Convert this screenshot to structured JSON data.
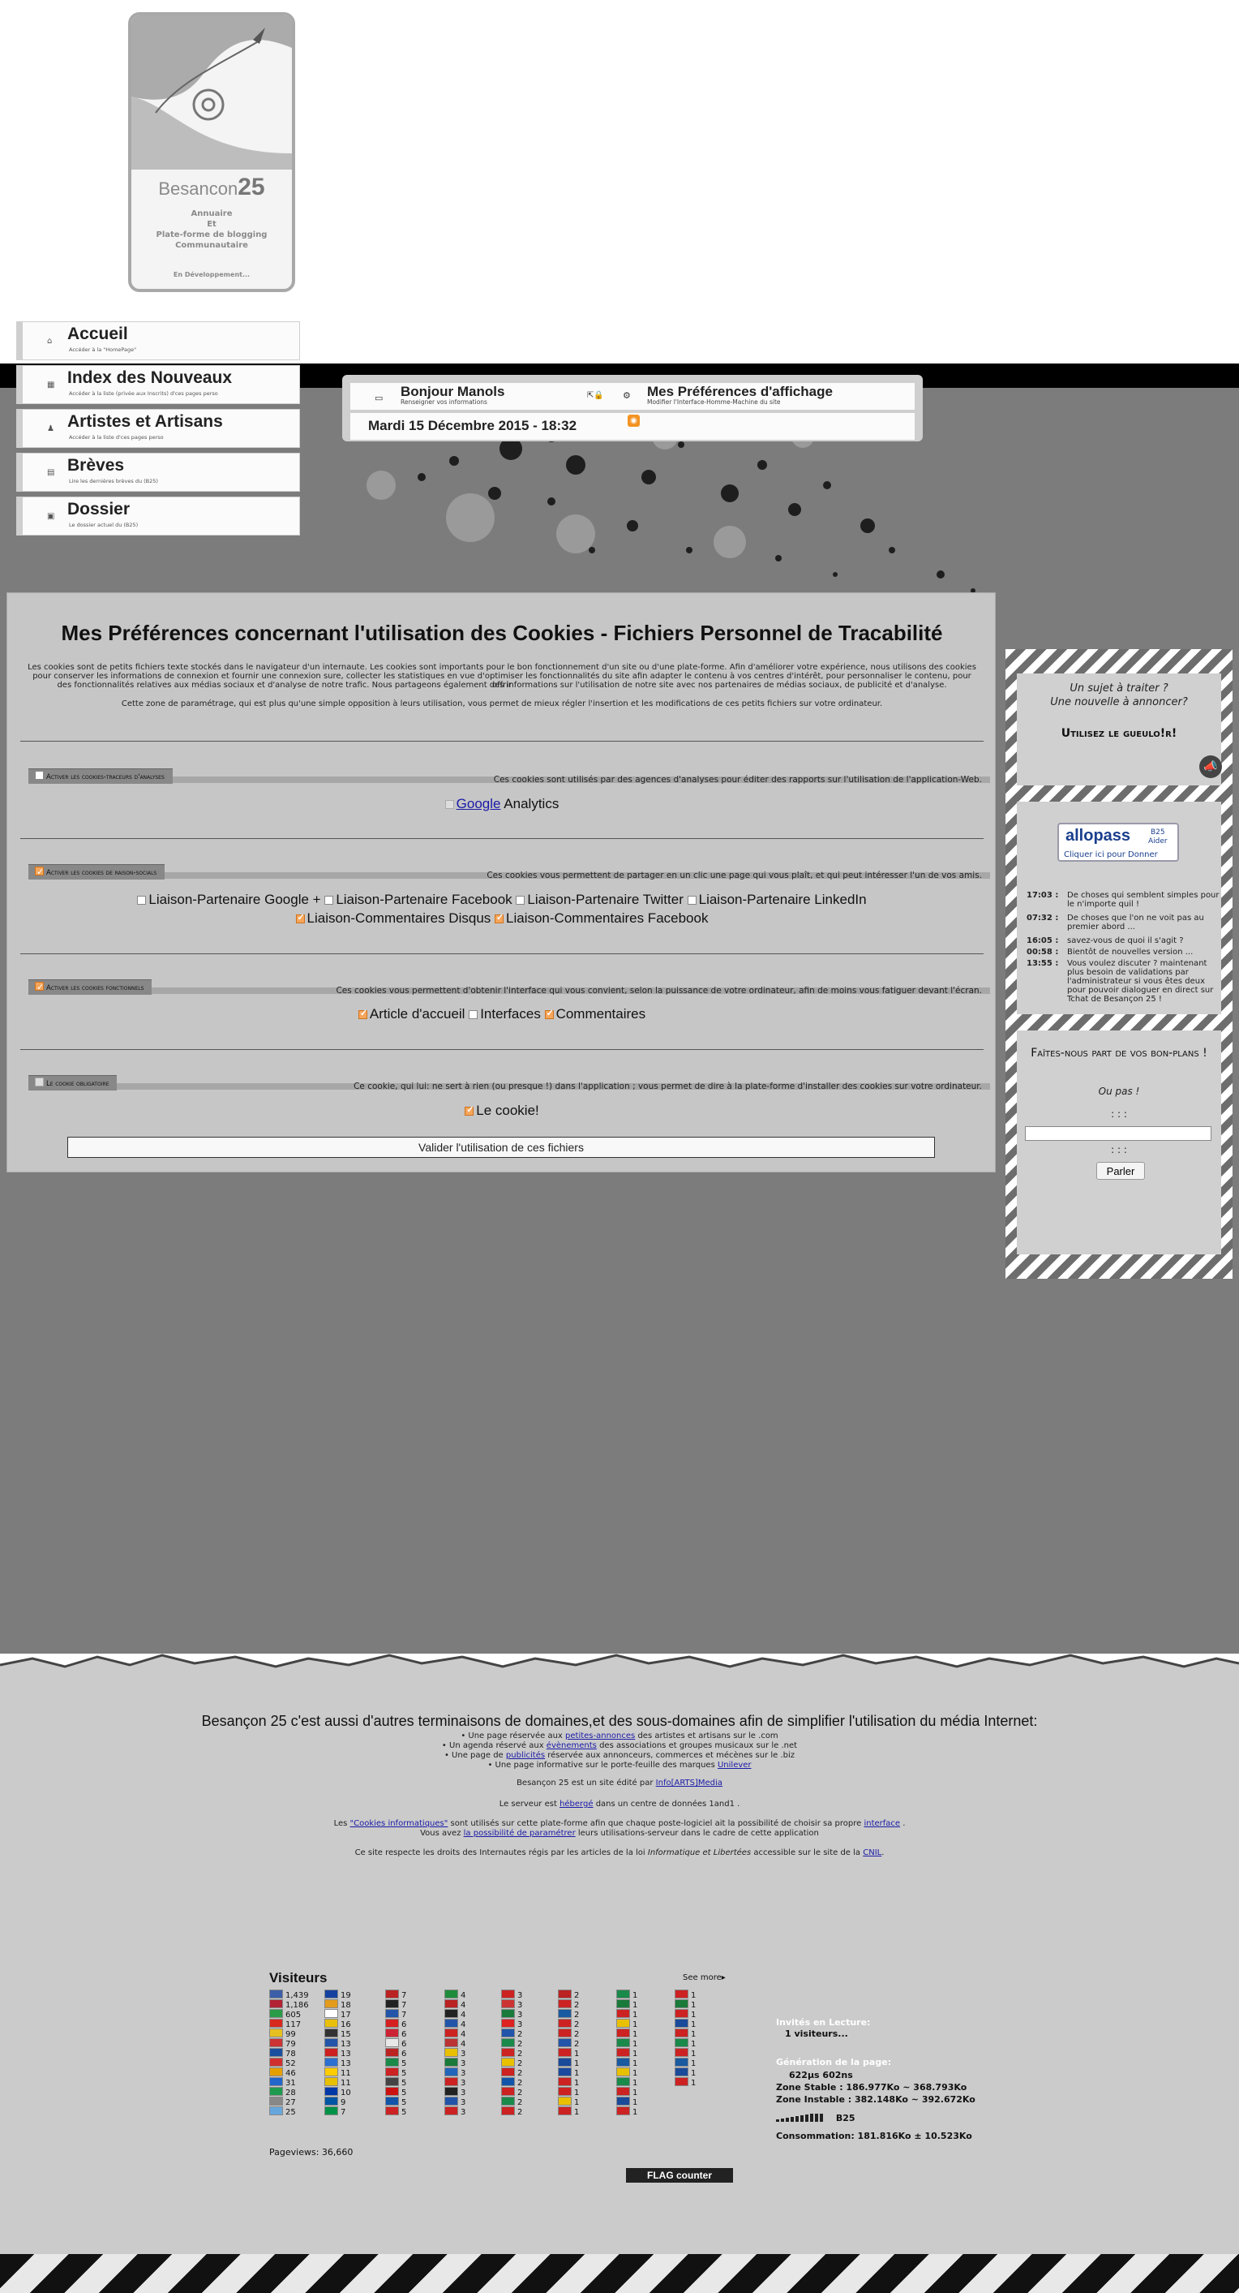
{
  "logo": {
    "name": "Besancon",
    "number": "25",
    "line1": "Annuaire",
    "line2": "Et",
    "line3": "Plate-forme de blogging",
    "line4": "Communautaire",
    "dev": "En Développement..."
  },
  "nav": [
    {
      "title": "Accueil",
      "sub": "Accéder à la \"HomePage\"",
      "icon": "home-icon"
    },
    {
      "title": "Index des Nouveaux",
      "sub": "Accéder à la liste (privée aux Inscrits) d'ces pages perso",
      "icon": "index-icon"
    },
    {
      "title": "Artistes et Artisans",
      "sub": "Accéder à la liste d'ces pages perso",
      "icon": "user-icon"
    },
    {
      "title": "Brèves",
      "sub": "Lire les dernières brèves du (B25)",
      "icon": "news-icon"
    },
    {
      "title": "Dossier",
      "sub": "Le dossier actuel du (B25)",
      "icon": "folder-icon"
    }
  ],
  "info_bar": {
    "user_title": "Bonjour Manols",
    "user_sub": "Renseigner vos informations",
    "prefs_title": "Mes Préférences d'affichage",
    "prefs_sub": "Modifier l'Interface-Homme-Machine du site",
    "date": "Mardi 15 Décembre 2015 - 18:32"
  },
  "cookies": {
    "title": "Mes Préférences concernant l'utilisation des Cookies - Fichiers Personnel de Tracabilité",
    "para1_l1": "Les cookies sont de petits fichiers texte stockés dans le navigateur d'un internaute. Les cookies sont importants pour le bon fonctionnement d'un site ou d'une plate-forme. Afin d'améliorer votre expérience, nous utilisons des cookies",
    "para1_l2": "pour conserver les informations de connexion et fournir une connexion sure, collecter les statistiques en vue d'optimiser les fonctionnalités du site afin adapter le contenu à vos centres d'intérêt, pour personnaliser le contenu, pour offrir",
    "para1_l3": "des fonctionnalités relatives aux médias sociaux et d'analyse de notre trafic. Nous partageons également des informations sur l'utilisation de notre site avec nos partenaires de médias sociaux, de publicité et d'analyse.",
    "para2": "Cette zone de paramétrage, qui est plus qu'une simple opposition à leurs utilisation, vous permet de mieux régler l'insertion et les modifications de ces petits fichiers sur votre ordinateur.",
    "sections": [
      {
        "tab": "Activer les cookies-traceurs d'analyses",
        "desc": "Ces cookies sont utilisés par des agences d'analyses pour éditer des rapports sur l'utilisation de l'application-Web.",
        "options": [
          "Google Analytics"
        ]
      },
      {
        "tab": "Activer les cookies de raison-socials",
        "desc": "Ces cookies vous permettent de partager en un clic une page qui vous plaît, et qui peut intéresser l'un de vos amis.",
        "options": [
          "Liaison-Partenaire Google +",
          "Liaison-Partenaire Facebook",
          "Liaison-Partenaire Twitter",
          "Liaison-Partenaire LinkedIn",
          "Liaison-Commentaires Disqus",
          "Liaison-Commentaires Facebook"
        ]
      },
      {
        "tab": "Activer les cookies fonctionnels",
        "desc": "Ces cookies vous permettent d'obtenir l'interface qui vous convient, selon la puissance de votre ordinateur, afin de moins vous fatiguer devant l'écran.",
        "options": [
          "Article d'accueil",
          "Interfaces",
          "Commentaires"
        ]
      },
      {
        "tab": "Le cookie obligatoire",
        "desc": "Ce cookie, qui lui: ne sert à rien (ou presque !) dans l'application ; vous permet de dire à la plate-forme d'installer des cookies sur votre ordinateur.",
        "options": [
          "Le cookie!"
        ]
      }
    ],
    "google_link": "Google",
    "analytics_text": "Analytics",
    "validate": "Valider l'utilisation de ces fichiers"
  },
  "sidebar": {
    "q1": "Un sujet à traiter ?",
    "q2": "Une nouvelle à annoncer?",
    "cta": "Utilisez le gueulo!r!",
    "allopass_brand": "allopass",
    "allopass_tag1": "B25",
    "allopass_tag2": "Aider",
    "allopass_cta": "Cliquer ici pour Donner",
    "chat": [
      {
        "time": "17:03 :",
        "msg": "De choses qui semblent simples pour le n'importe quil !"
      },
      {
        "time": "07:32 :",
        "msg": "De choses que l'on ne voit pas au premier abord ..."
      },
      {
        "time": "16:05 :",
        "msg": "savez-vous de quoi il s'agit ?"
      },
      {
        "time": "00:58 :",
        "msg": "Bientôt de nouvelles version ..."
      },
      {
        "time": "13:55 :",
        "msg": "Vous voulez discuter ? maintenant plus besoin de validations par l'administrateur si vous êtes deux pour pouvoir dialoguer en direct sur Tchat de Besançon 25 !"
      }
    ],
    "bon_plans": "Faîtes-nous part de vos bon-plans !",
    "ou_pas": "Ou pas !",
    "dots": ": : :",
    "dots2": ": : :",
    "speak": "Parler"
  },
  "footer": {
    "head": "Besançon 25 c'est aussi d'autres terminaisons de domaines,et des sous-domaines afin de simplifier l'utilisation du média Internet:",
    "l1_pre": "• Une page réservée aux",
    "l1_link": "petites-annonces",
    "l1_post": "des artistes et artisans sur le .com",
    "l2_pre": "• Un agenda réservé aux",
    "l2_link": "évènements",
    "l2_post": "des associations et groupes musicaux sur le .net",
    "l3_pre": "• Une page de",
    "l3_link": "publicités",
    "l3_post": "réservée aux annonceurs, commerces et mécènes sur le .biz",
    "l4_pre": "• Une page informative sur le porte-feuille des marques",
    "l4_link": "Unilever",
    "l5_pre": "Besançon 25 est un site édité par",
    "l5_link": "Info[ARTS]Media",
    "l6_pre": "Le serveur est",
    "l6_link": "hébergé",
    "l6_post": "dans un centre de données 1and1 .",
    "l7_pre": "Les",
    "l7_link": "\"Cookies informatiques\"",
    "l7_post": "sont utilisés sur cette plate-forme afin que chaque poste-logiciel ait la possibilité de choisir sa propre",
    "l7_link2": "interface",
    "l7_end": ".",
    "l8_pre": "Vous avez",
    "l8_link": "la possibilité de paramétrer",
    "l8_post": "leurs utilisations-serveur dans le cadre de cette application",
    "l9_pre": "Ce site respecte les droits des Internautes régis par les articles de la loi",
    "l9_em": "Informatique et Libertées",
    "l9_post": "accessible sur le site de la",
    "l9_link": "CNIL"
  },
  "visitors": {
    "title": "Visiteurs",
    "see_more": "See more▸",
    "pageviews": "Pageviews: 36,660",
    "columns": [
      [
        [
          "#3c5fa8",
          "1,439"
        ],
        [
          "#b22234",
          "1,186"
        ],
        [
          "#2a9c48",
          "605"
        ],
        [
          "#d7291e",
          "117"
        ],
        [
          "#e6c020",
          "99"
        ],
        [
          "#cc3333",
          "79"
        ],
        [
          "#1a4fa0",
          "78"
        ],
        [
          "#d12f2f",
          "52"
        ],
        [
          "#e5a000",
          "46"
        ],
        [
          "#2266cc",
          "31"
        ],
        [
          "#1e9a4e",
          "28"
        ],
        [
          "#888888",
          "27"
        ],
        [
          "#67a6dd",
          "25"
        ]
      ],
      [
        [
          "#1540a0",
          "19"
        ],
        [
          "#e39b1b",
          "18"
        ],
        [
          "#ffffff",
          "17"
        ],
        [
          "#e8c00a",
          "16"
        ],
        [
          "#333333",
          "15"
        ],
        [
          "#2255aa",
          "13"
        ],
        [
          "#cf2020",
          "13"
        ],
        [
          "#2b6fd0",
          "13"
        ],
        [
          "#ffcc00",
          "11"
        ],
        [
          "#e8c000",
          "11"
        ],
        [
          "#0038a8",
          "10"
        ],
        [
          "#0055a4",
          "9"
        ],
        [
          "#009246",
          "7"
        ]
      ],
      [
        [
          "#bb2222",
          "7"
        ],
        [
          "#222222",
          "7"
        ],
        [
          "#2255aa",
          "7"
        ],
        [
          "#d42020",
          "6"
        ],
        [
          "#cc2233",
          "6"
        ],
        [
          "#e8e8e8",
          "6"
        ],
        [
          "#bb2222",
          "6"
        ],
        [
          "#1a8a4a",
          "5"
        ],
        [
          "#cc2222",
          "5"
        ],
        [
          "#444444",
          "5"
        ],
        [
          "#cc1111",
          "5"
        ],
        [
          "#1155aa",
          "5"
        ],
        [
          "#cc2222",
          "5"
        ]
      ],
      [
        [
          "#1e8c3a",
          "4"
        ],
        [
          "#bb2222",
          "4"
        ],
        [
          "#222222",
          "4"
        ],
        [
          "#2255aa",
          "4"
        ],
        [
          "#cc2222",
          "4"
        ],
        [
          "#bb3333",
          "4"
        ],
        [
          "#e8c000",
          "3"
        ],
        [
          "#1a7a3a",
          "3"
        ],
        [
          "#2266bb",
          "3"
        ],
        [
          "#cc2222",
          "3"
        ],
        [
          "#222222",
          "3"
        ],
        [
          "#2255aa",
          "3"
        ],
        [
          "#cc2222",
          "3"
        ]
      ],
      [
        [
          "#cc2222",
          "3"
        ],
        [
          "#cc3333",
          "3"
        ],
        [
          "#1a7a3a",
          "3"
        ],
        [
          "#dd2222",
          "3"
        ],
        [
          "#2255aa",
          "2"
        ],
        [
          "#1a8a4a",
          "2"
        ],
        [
          "#cc2222",
          "2"
        ],
        [
          "#e8c000",
          "2"
        ],
        [
          "#cc2222",
          "2"
        ],
        [
          "#1155aa",
          "2"
        ],
        [
          "#cc2222",
          "2"
        ],
        [
          "#1a8a4a",
          "2"
        ],
        [
          "#cc2222",
          "2"
        ]
      ],
      [
        [
          "#bb2222",
          "2"
        ],
        [
          "#cc2222",
          "2"
        ],
        [
          "#1a5aa0",
          "2"
        ],
        [
          "#cc2222",
          "2"
        ],
        [
          "#cc2222",
          "2"
        ],
        [
          "#2255aa",
          "2"
        ],
        [
          "#cc2222",
          "1"
        ],
        [
          "#1a4a9a",
          "1"
        ],
        [
          "#1a4aa0",
          "1"
        ],
        [
          "#cc2222",
          "1"
        ],
        [
          "#cc2222",
          "1"
        ],
        [
          "#e8c000",
          "1"
        ],
        [
          "#cc2222",
          "1"
        ]
      ],
      [
        [
          "#1a8a4a",
          "1"
        ],
        [
          "#1a7a3a",
          "1"
        ],
        [
          "#cc2222",
          "1"
        ],
        [
          "#e8c000",
          "1"
        ],
        [
          "#cc2222",
          "1"
        ],
        [
          "#1a8a4a",
          "1"
        ],
        [
          "#cc2222",
          "1"
        ],
        [
          "#1a5aa0",
          "1"
        ],
        [
          "#e8c000",
          "1"
        ],
        [
          "#1a8a4a",
          "1"
        ],
        [
          "#cc2222",
          "1"
        ],
        [
          "#1a4a9a",
          "1"
        ],
        [
          "#cc2222",
          "1"
        ]
      ],
      [
        [
          "#cc2222",
          "1"
        ],
        [
          "#1a7a3a",
          "1"
        ],
        [
          "#cc2222",
          "1"
        ],
        [
          "#1a4a9a",
          "1"
        ],
        [
          "#cc2222",
          "1"
        ],
        [
          "#1a8a4a",
          "1"
        ],
        [
          "#cc2222",
          "1"
        ],
        [
          "#1a5aa0",
          "1"
        ],
        [
          "#1a4a9a",
          "1"
        ],
        [
          "#cc2222",
          "1"
        ]
      ]
    ]
  },
  "flag_counter": "FLAG counter",
  "stats": {
    "invites_label": "Invités en Lecture:",
    "invites_value": "1 visiteurs...",
    "gen_label": "Génération de la page:",
    "gen_value": "622µs 602ns",
    "stable": "Zone Stable : 186.977Ko ~ 368.793Ko",
    "instable": "Zone Instable : 382.148Ko ~ 392.672Ko",
    "b25": "B25",
    "conso": "Consommation: 181.816Ko ± 10.523Ko"
  }
}
